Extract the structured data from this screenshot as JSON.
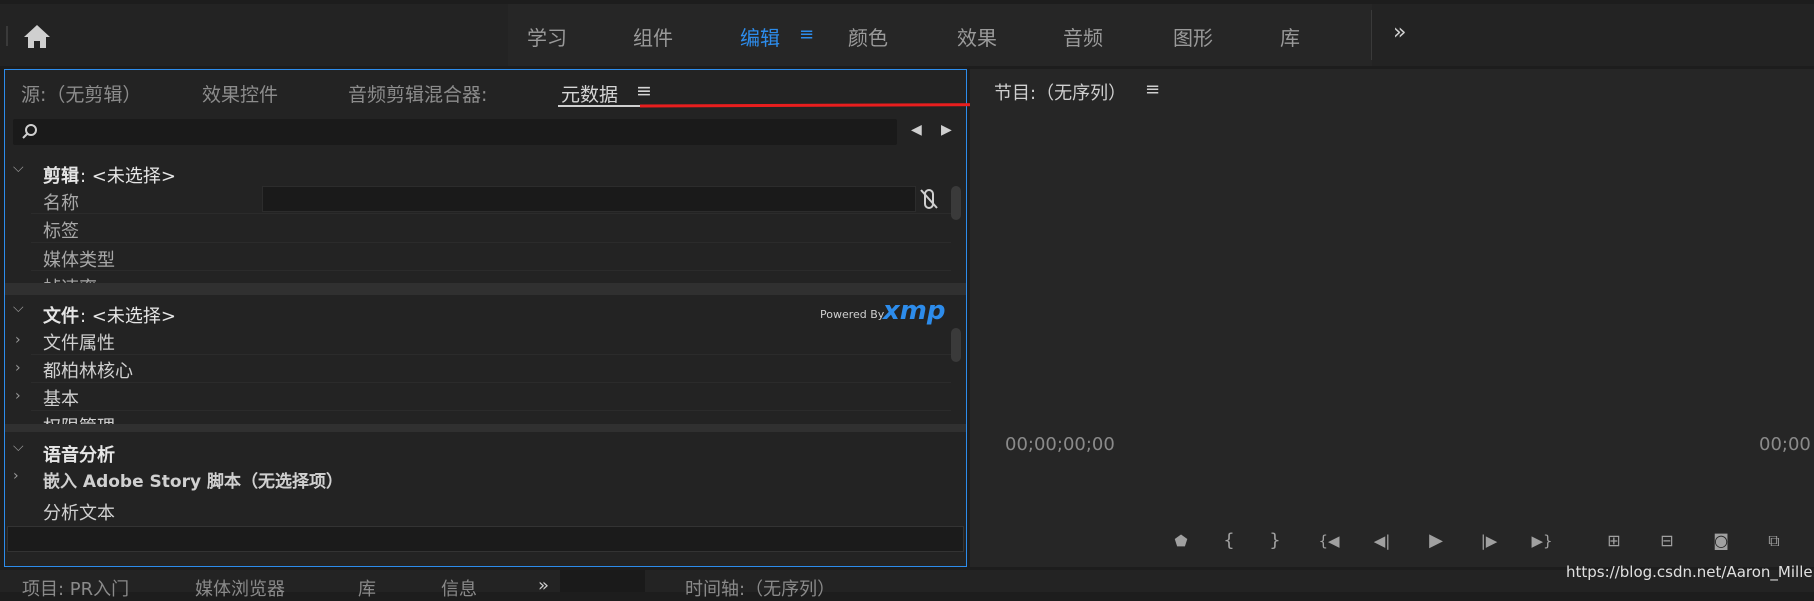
{
  "workspace_tabs": [
    "学习",
    "组件",
    "编辑",
    "颜色",
    "效果",
    "音频",
    "图形",
    "库"
  ],
  "active_tab": "编辑",
  "overflow_icon": "»",
  "metadata_panel": {
    "tabs": [
      "源:（无剪辑）",
      "效果控件",
      "音频剪辑混合器:",
      "元数据"
    ],
    "active_tab": "元数据",
    "menu_icon": "≡",
    "clip_section": {
      "title": "剪辑",
      "value": ": <未选择>",
      "rows": [
        "名称",
        "标签",
        "媒体类型",
        "帧速率"
      ]
    },
    "file_section": {
      "title": "文件",
      "value": ": <未选择>",
      "powered_by": "Powered By",
      "xmp": "xmp",
      "rows": [
        "文件属性",
        "都柏林核心",
        "基本",
        "权限管理"
      ]
    },
    "speech_section": {
      "title": "语音分析",
      "embed": "嵌入 Adobe Story 脚本（无选择项）",
      "analyze": "分析文本"
    }
  },
  "program_panel": {
    "title": "节目:（无序列）",
    "menu_icon": "≡",
    "timecode_left": "00;00;00;00",
    "timecode_right": "00;00"
  },
  "bottom_tabs": {
    "project": "项目: PR入门",
    "media_browser": "媒体浏览器",
    "library": "库",
    "info": "信息",
    "timeline": "时间轴:（无序列）"
  },
  "watermark": "https://blog.csdn.net/Aaron_Miller",
  "colors": {
    "accent": "#2d8ceb",
    "arrow": "#e81e1e",
    "panel": "#232323"
  }
}
